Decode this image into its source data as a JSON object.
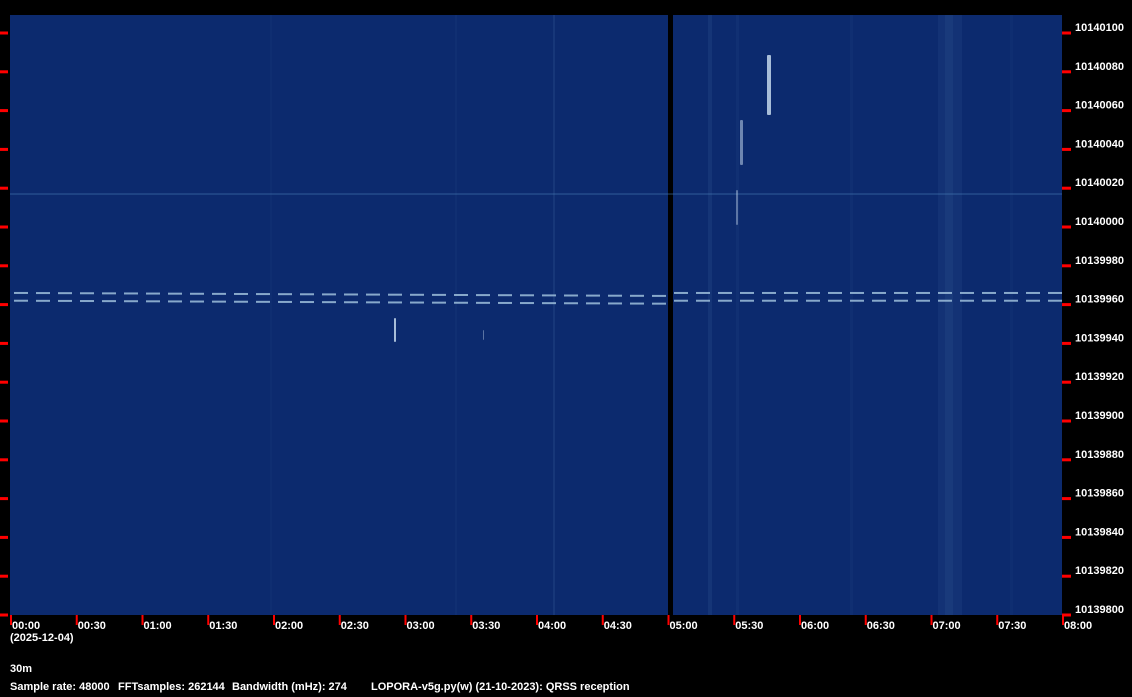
{
  "chart_data": {
    "type": "heatmap",
    "description_kind": "spectrogram",
    "x_ticks": [
      "00:00",
      "00:30",
      "01:00",
      "01:30",
      "02:00",
      "02:30",
      "03:00",
      "03:30",
      "04:00",
      "04:30",
      "05:00",
      "05:30",
      "06:00",
      "06:30",
      "07:00",
      "07:30",
      "08:00"
    ],
    "x_range": [
      "00:00",
      "08:00"
    ],
    "y_ticks": [
      10140100,
      10140080,
      10140060,
      10140040,
      10140020,
      10140000,
      10139980,
      10139960,
      10139940,
      10139920,
      10139900,
      10139880,
      10139860,
      10139840,
      10139820,
      10139800
    ],
    "y_range": [
      10139800,
      10140108
    ],
    "date_label": "(2025-12-04)",
    "traces": [
      {
        "kind": "dashed-carrier-pair",
        "freq_hz": [
          10139966,
          10139962
        ],
        "time": [
          "00:00",
          "08:00"
        ]
      },
      {
        "kind": "steady-carrier",
        "freq_hz": 10140017,
        "time": [
          "00:00",
          "08:00"
        ]
      }
    ],
    "colors": {
      "background": "#0c2a6e",
      "signal": "#9fc0dc",
      "tick": "#ff0000",
      "text": "#ffffff"
    }
  },
  "footer": {
    "band": "30m",
    "sample_rate": "Sample rate: 48000",
    "fft_samples": "FFTsamples: 262144",
    "bandwidth": "Bandwidth (mHz): 274",
    "software": "LOPORA-v5g.py(w) (21-10-2023): QRSS reception"
  }
}
